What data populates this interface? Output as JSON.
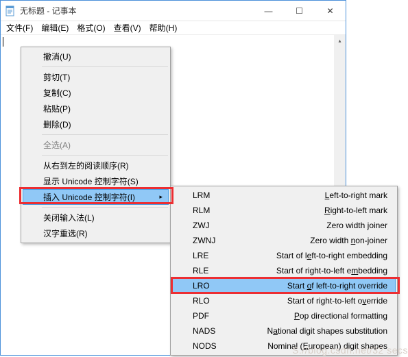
{
  "window": {
    "title": "无标题 - 记事本",
    "min": "—",
    "max": "☐",
    "close": "✕"
  },
  "menubar": {
    "items": [
      "文件(F)",
      "编辑(E)",
      "格式(O)",
      "查看(V)",
      "帮助(H)"
    ]
  },
  "context_menu": {
    "items": [
      {
        "label": "撤消(U)",
        "enabled": true
      },
      {
        "sep": true
      },
      {
        "label": "剪切(T)",
        "enabled": true
      },
      {
        "label": "复制(C)",
        "enabled": true
      },
      {
        "label": "粘贴(P)",
        "enabled": true
      },
      {
        "label": "删除(D)",
        "enabled": true
      },
      {
        "sep": true
      },
      {
        "label": "全选(A)",
        "enabled": false
      },
      {
        "sep": true
      },
      {
        "label": "从右到左的阅读顺序(R)",
        "enabled": true
      },
      {
        "label": "显示 Unicode 控制字符(S)",
        "enabled": true
      },
      {
        "label": "插入 Unicode 控制字符(I)",
        "enabled": true,
        "submenu": true,
        "highlighted": true
      },
      {
        "sep": true
      },
      {
        "label": "关闭输入法(L)",
        "enabled": true
      },
      {
        "label": "汉字重选(R)",
        "enabled": true
      }
    ]
  },
  "submenu": {
    "items": [
      {
        "code": "LRM",
        "desc": "Left-to-right mark",
        "u": "L"
      },
      {
        "code": "RLM",
        "desc": "Right-to-left mark",
        "u": "R"
      },
      {
        "code": "ZWJ",
        "desc": "Zero width joiner",
        "u": "j"
      },
      {
        "code": "ZWNJ",
        "desc": "Zero width non-joiner",
        "u": "n"
      },
      {
        "code": "LRE",
        "desc": "Start of left-to-right embedding",
        "u": "e"
      },
      {
        "code": "RLE",
        "desc": "Start of right-to-left embedding",
        "u": "m"
      },
      {
        "code": "LRO",
        "desc": "Start of left-to-right override",
        "u": "o",
        "highlighted": true
      },
      {
        "code": "RLO",
        "desc": "Start of right-to-left override",
        "u": "v"
      },
      {
        "code": "PDF",
        "desc": "Pop directional formatting",
        "u": "P"
      },
      {
        "code": "NADS",
        "desc": "National digit shapes substitution",
        "u": "a"
      },
      {
        "code": "NODS",
        "desc": "Nominal (European) digit shapes",
        "u": "E"
      }
    ]
  },
  "watermark": "S://blog.csdn.net/32 secs"
}
